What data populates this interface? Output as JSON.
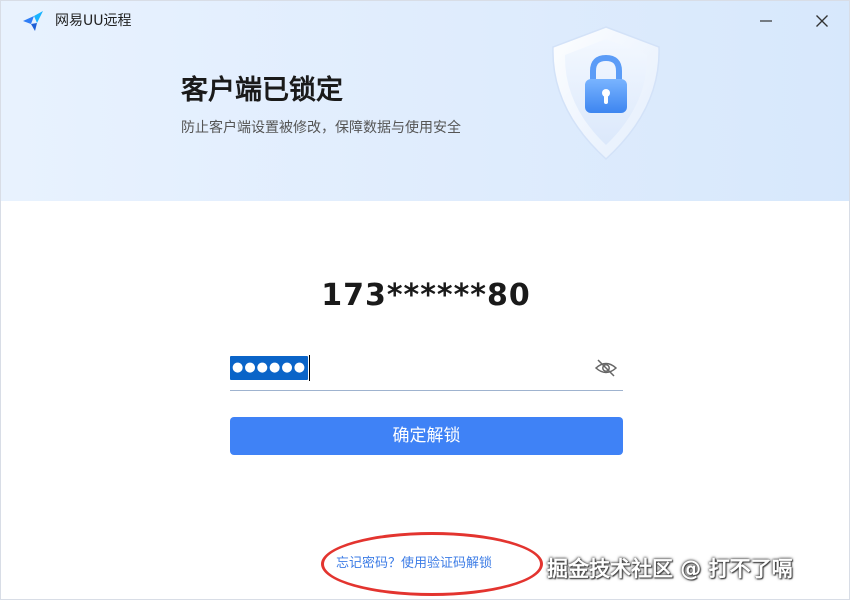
{
  "window": {
    "app_title": "网易UU远程"
  },
  "banner": {
    "title": "客户端已锁定",
    "subtitle": "防止客户端设置被修改，保障数据与使用安全"
  },
  "main": {
    "account": "173******80",
    "password_mask": "●●●●●●",
    "confirm_label": "确定解锁",
    "forgot_link": "忘记密码？使用验证码解锁"
  },
  "overlay": {
    "watermark": "掘金技术社区 @ 打不了嗝"
  },
  "colors": {
    "accent": "#3f82f6",
    "banner_bg": "#dfecfd",
    "link": "#3c7ce6",
    "annotation": "#e3342f"
  },
  "icons": [
    "app-logo-icon",
    "minimize-icon",
    "close-icon",
    "shield-lock-icon",
    "eye-off-icon"
  ]
}
